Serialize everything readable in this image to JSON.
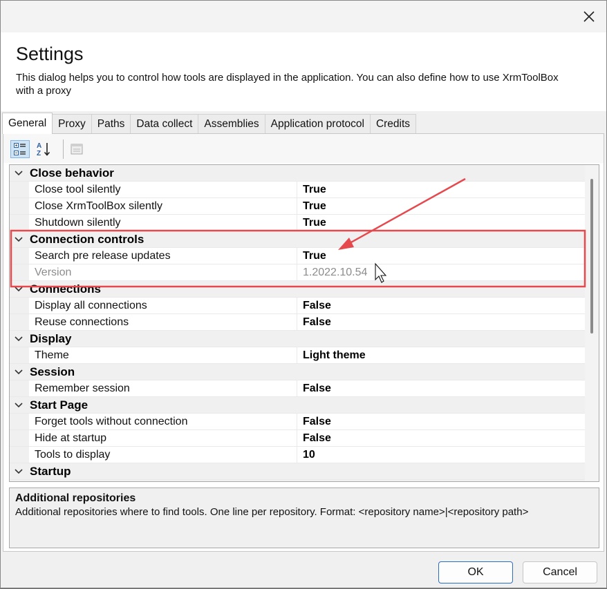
{
  "dialog": {
    "title": "Settings",
    "description": "This dialog helps you to control how tools are displayed in the application. You can also define how to use XrmToolBox with a proxy"
  },
  "tabs": [
    "General",
    "Proxy",
    "Paths",
    "Data collect",
    "Assemblies",
    "Application protocol",
    "Credits"
  ],
  "active_tab": "General",
  "toolbar": {
    "categorized_icon": "categorized-view-icon",
    "alphabetical_icon": "sort-az-icon",
    "property_pages_icon": "property-pages-icon"
  },
  "grid": {
    "categories": [
      {
        "name": "Close behavior",
        "props": [
          {
            "name": "Close tool silently",
            "value": "True"
          },
          {
            "name": "Close XrmToolBox silently",
            "value": "True"
          },
          {
            "name": "Shutdown silently",
            "value": "True"
          }
        ]
      },
      {
        "name": "Connection controls",
        "props": [
          {
            "name": "Search pre release updates",
            "value": "True"
          },
          {
            "name": "Version",
            "value": "1.2022.10.54"
          }
        ]
      },
      {
        "name": "Connections",
        "props": [
          {
            "name": "Display all connections",
            "value": "False"
          },
          {
            "name": "Reuse connections",
            "value": "False"
          }
        ]
      },
      {
        "name": "Display",
        "props": [
          {
            "name": "Theme",
            "value": "Light theme"
          }
        ]
      },
      {
        "name": "Session",
        "props": [
          {
            "name": "Remember session",
            "value": "False"
          }
        ]
      },
      {
        "name": "Start Page",
        "props": [
          {
            "name": "Forget tools without connection",
            "value": "False"
          },
          {
            "name": "Hide at startup",
            "value": "False"
          },
          {
            "name": "Tools to display",
            "value": "10"
          }
        ]
      },
      {
        "name": "Startup",
        "props": []
      }
    ]
  },
  "help": {
    "title": "Additional repositories",
    "text": "Additional repositories where to find tools. One line per repository. Format: <repository name>|<repository path>"
  },
  "buttons": {
    "ok": "OK",
    "cancel": "Cancel"
  },
  "colors": {
    "annotation": "#e5484d",
    "default_button_border": "#2d6cbf"
  }
}
